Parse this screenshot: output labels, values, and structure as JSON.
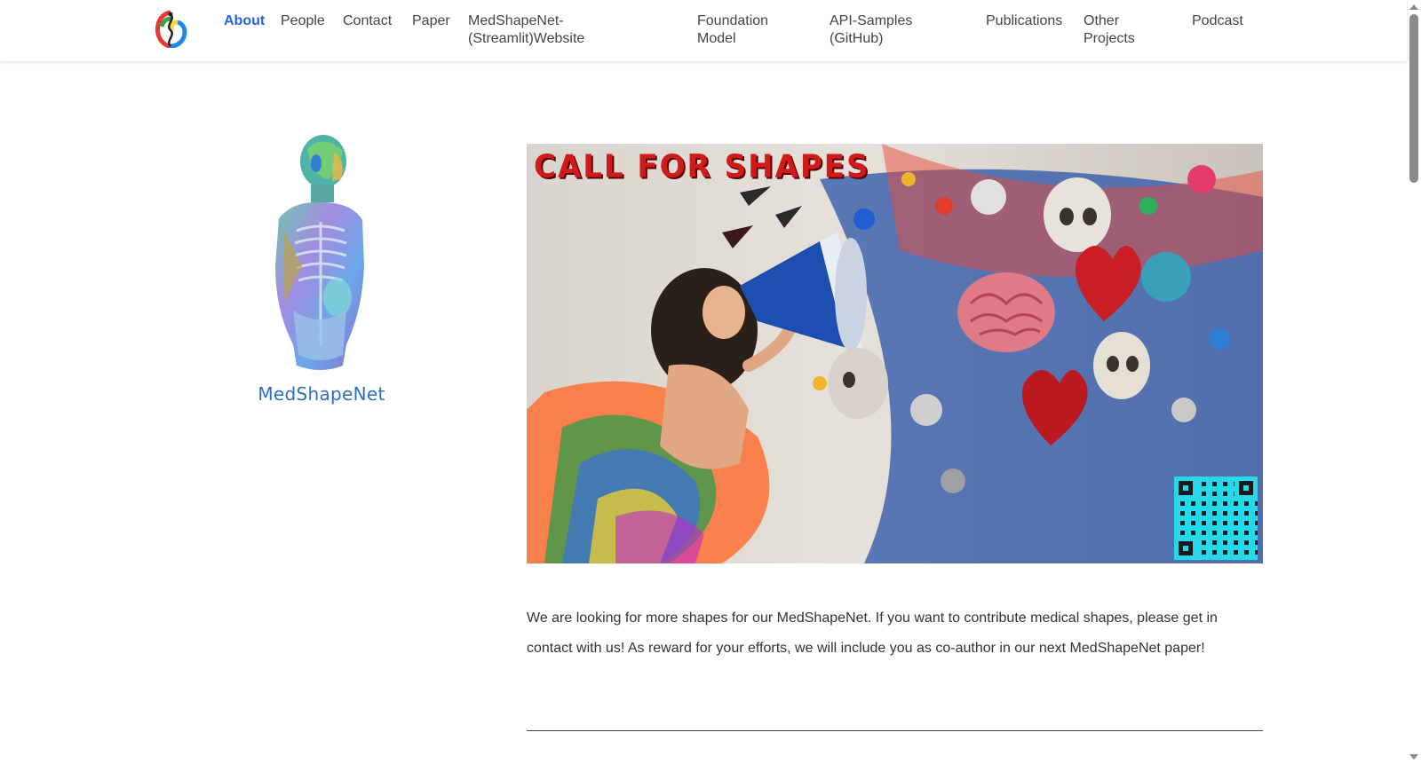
{
  "nav": {
    "items": [
      {
        "label": "About",
        "active": true
      },
      {
        "label": "People"
      },
      {
        "label": "Contact"
      },
      {
        "label": "Paper"
      },
      {
        "label": "MedShapeNet-(Streamlit)Website"
      },
      {
        "label": "Foundation Model"
      },
      {
        "label": "API-Samples (GitHub)"
      },
      {
        "label": "Publications"
      },
      {
        "label": "Other Projects"
      },
      {
        "label": "Podcast"
      }
    ]
  },
  "profile": {
    "name": "MedShapeNet"
  },
  "banner": {
    "title": "CALL FOR SHAPES"
  },
  "main": {
    "intro": "We are looking for more shapes for our MedShapeNet. If you want to contribute medical shapes, please get in contact with us! As reward for your efforts, we will include you as co-author in our next MedShapeNet paper!"
  },
  "colors": {
    "accent": "#2665d8",
    "name": "#2f6fbf",
    "banner_title": "#d11a1a",
    "qr": "#27d8e8"
  }
}
